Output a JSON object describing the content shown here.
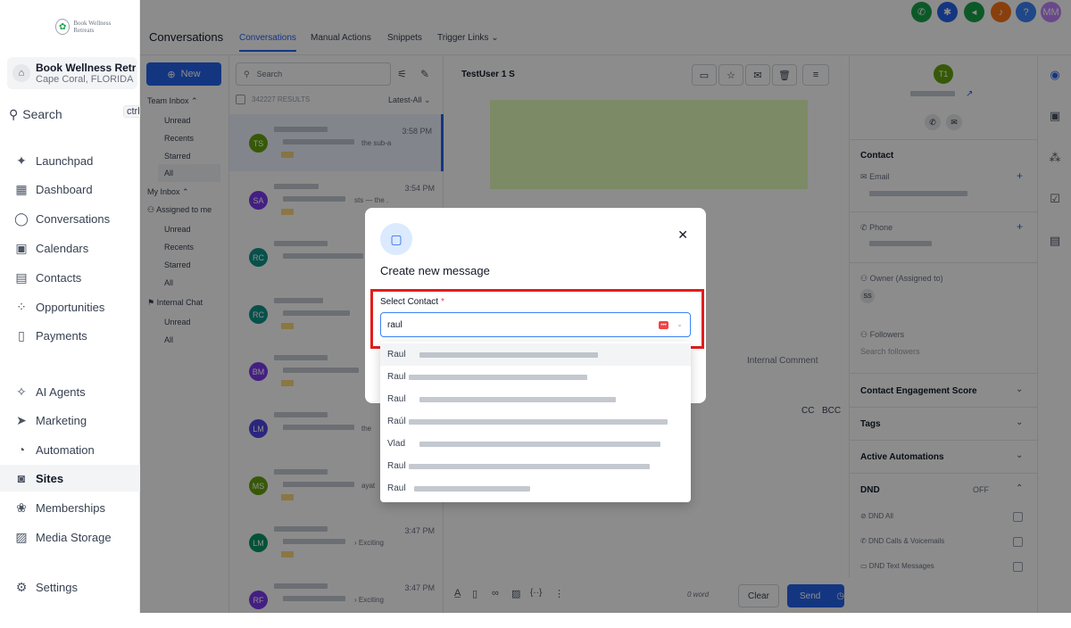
{
  "sidebar": {
    "logo_text": "Book Wellness Retreats",
    "account_name": "Book Wellness Retre...",
    "account_location": "Cape Coral, FLORIDA",
    "search_label": "Search",
    "search_shortcut": "ctrl K",
    "items": [
      {
        "label": "Launchpad",
        "icon": "rocket-icon"
      },
      {
        "label": "Dashboard",
        "icon": "grid-icon"
      },
      {
        "label": "Conversations",
        "icon": "chat-icon"
      },
      {
        "label": "Calendars",
        "icon": "calendar-icon"
      },
      {
        "label": "Contacts",
        "icon": "contacts-icon"
      },
      {
        "label": "Opportunities",
        "icon": "opportunities-icon"
      },
      {
        "label": "Payments",
        "icon": "payments-icon"
      },
      {
        "label": "AI Agents",
        "icon": "sparkle-icon"
      },
      {
        "label": "Marketing",
        "icon": "send-icon"
      },
      {
        "label": "Automation",
        "icon": "automation-icon"
      },
      {
        "label": "Sites",
        "icon": "sites-icon"
      },
      {
        "label": "Memberships",
        "icon": "membership-icon"
      },
      {
        "label": "Media Storage",
        "icon": "image-icon"
      },
      {
        "label": "Settings",
        "icon": "gear-icon"
      }
    ]
  },
  "header": {
    "title": "Conversations",
    "tabs": [
      "Conversations",
      "Manual Actions",
      "Snippets",
      "Trigger Links"
    ],
    "avatar_initials": "MM"
  },
  "inbox": {
    "new_label": "New",
    "team_inbox": "Team Inbox",
    "team_items": [
      "Unread",
      "Recents",
      "Starred",
      "All"
    ],
    "my_inbox": "My Inbox",
    "assigned": "Assigned to me",
    "my_items": [
      "Unread",
      "Recents",
      "Starred",
      "All"
    ],
    "internal_chat": "Internal Chat",
    "chat_items": [
      "Unread",
      "All"
    ]
  },
  "conversations": {
    "search_placeholder": "Search",
    "results": "342227 RESULTS",
    "sort": "Latest-All",
    "rows": [
      {
        "initials": "TS",
        "time": "3:58 PM",
        "snippet": "the sub-a",
        "color": "#65a30d"
      },
      {
        "initials": "SA",
        "time": "3:54 PM",
        "snippet": "sts — the .",
        "color": "#7c3aed"
      },
      {
        "initials": "RC",
        "time": "",
        "snippet": "",
        "color": "#0d9488"
      },
      {
        "initials": "RC",
        "time": "",
        "snippet": "",
        "color": "#0d9488"
      },
      {
        "initials": "BM",
        "time": "",
        "snippet": "",
        "color": "#7c3aed"
      },
      {
        "initials": "LM",
        "time": "",
        "snippet": "the",
        "color": "#4f46e5"
      },
      {
        "initials": "MS",
        "time": "",
        "snippet": "ayat",
        "color": "#65a30d"
      },
      {
        "initials": "LM",
        "time": "3:47 PM",
        "snippet": "› Exciting",
        "color": "#059669"
      },
      {
        "initials": "RF",
        "time": "3:47 PM",
        "snippet": "› Exciting",
        "color": "#7c3aed"
      }
    ]
  },
  "chat": {
    "contact_name": "TestUser 1 S",
    "internal_comment": "Internal Comment",
    "cc": "CC",
    "bcc": "BCC",
    "word_count": "0 word",
    "clear": "Clear",
    "send": "Send"
  },
  "details": {
    "initials": "T1",
    "contact": "Contact",
    "email": "Email",
    "phone": "Phone",
    "owner": "Owner (Assigned to)",
    "owner_initials": "SS",
    "followers": "Followers",
    "followers_placeholder": "Search followers",
    "engagement": "Contact Engagement Score",
    "tags": "Tags",
    "automations": "Active Automations",
    "dnd": "DND",
    "dnd_status": "OFF",
    "dnd_all": "DND All",
    "dnd_calls": "DND Calls & Voicemails",
    "dnd_text": "DND Text Messages"
  },
  "modal": {
    "title": "Create new message",
    "select_contact_label": "Select Contact",
    "required_mark": "*",
    "input_value": "raul",
    "options": [
      "Raul",
      "Raul",
      "Raul",
      "Raúl",
      "Vlad",
      "Raul",
      "Raul"
    ]
  },
  "colors": {
    "accent": "#2563eb",
    "highlight": "#e11d1d",
    "bubble": "#d9f99d"
  }
}
